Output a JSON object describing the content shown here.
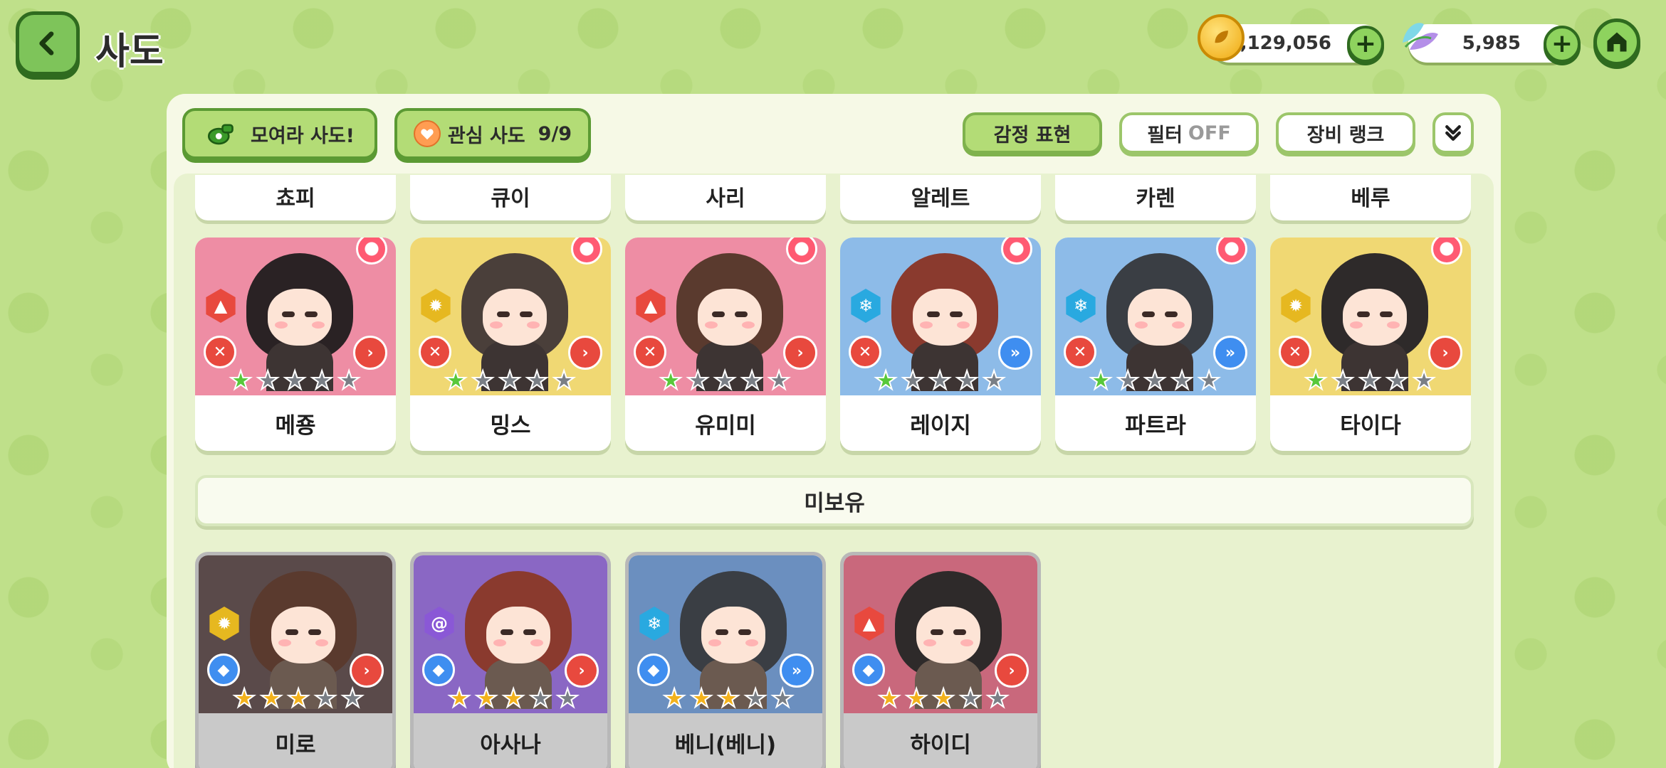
{
  "header": {
    "title": "사도",
    "gold": "8,129,056",
    "gems": "5,985"
  },
  "toolbar": {
    "gather": "모여라 사도!",
    "favorite_label": "관심 사도",
    "favorite_count": "9/9",
    "emotion": "감정 표현",
    "filter": "필터",
    "filter_state": "OFF",
    "equip_rank": "장비 랭크"
  },
  "top_row_names": [
    "쵸피",
    "큐이",
    "사리",
    "알레트",
    "카렌",
    "베루"
  ],
  "owned": [
    {
      "name": "메죵",
      "bg": "#ee8da4",
      "element": "fire",
      "stars": 1
    },
    {
      "name": "밍스",
      "bg": "#f0d873",
      "element": "light",
      "stars": 1
    },
    {
      "name": "유미미",
      "bg": "#ee8da4",
      "element": "fire",
      "stars": 1
    },
    {
      "name": "레이지",
      "bg": "#8dbbe8",
      "element": "ice",
      "stars": 1
    },
    {
      "name": "파트라",
      "bg": "#8dbbe8",
      "element": "ice",
      "stars": 1
    },
    {
      "name": "타이다",
      "bg": "#f0d873",
      "element": "light",
      "stars": 1
    }
  ],
  "section_unowned": "미보유",
  "unowned": [
    {
      "name": "미로",
      "bg": "#5a4a4a",
      "element": "light",
      "stars": 3
    },
    {
      "name": "아사나",
      "bg": "#8a67c4",
      "element": "wind",
      "stars": 3
    },
    {
      "name": "베니(베니)",
      "bg": "#6b8fbf",
      "element": "ice",
      "stars": 3
    },
    {
      "name": "하이디",
      "bg": "#c9687c",
      "element": "fire",
      "stars": 3
    }
  ],
  "colors": {
    "fire": "#e8493e",
    "light": "#e6b820",
    "ice": "#29a9e0",
    "wind": "#8a58d6",
    "role": "#e8493e",
    "dir": "#3f8ef0"
  }
}
